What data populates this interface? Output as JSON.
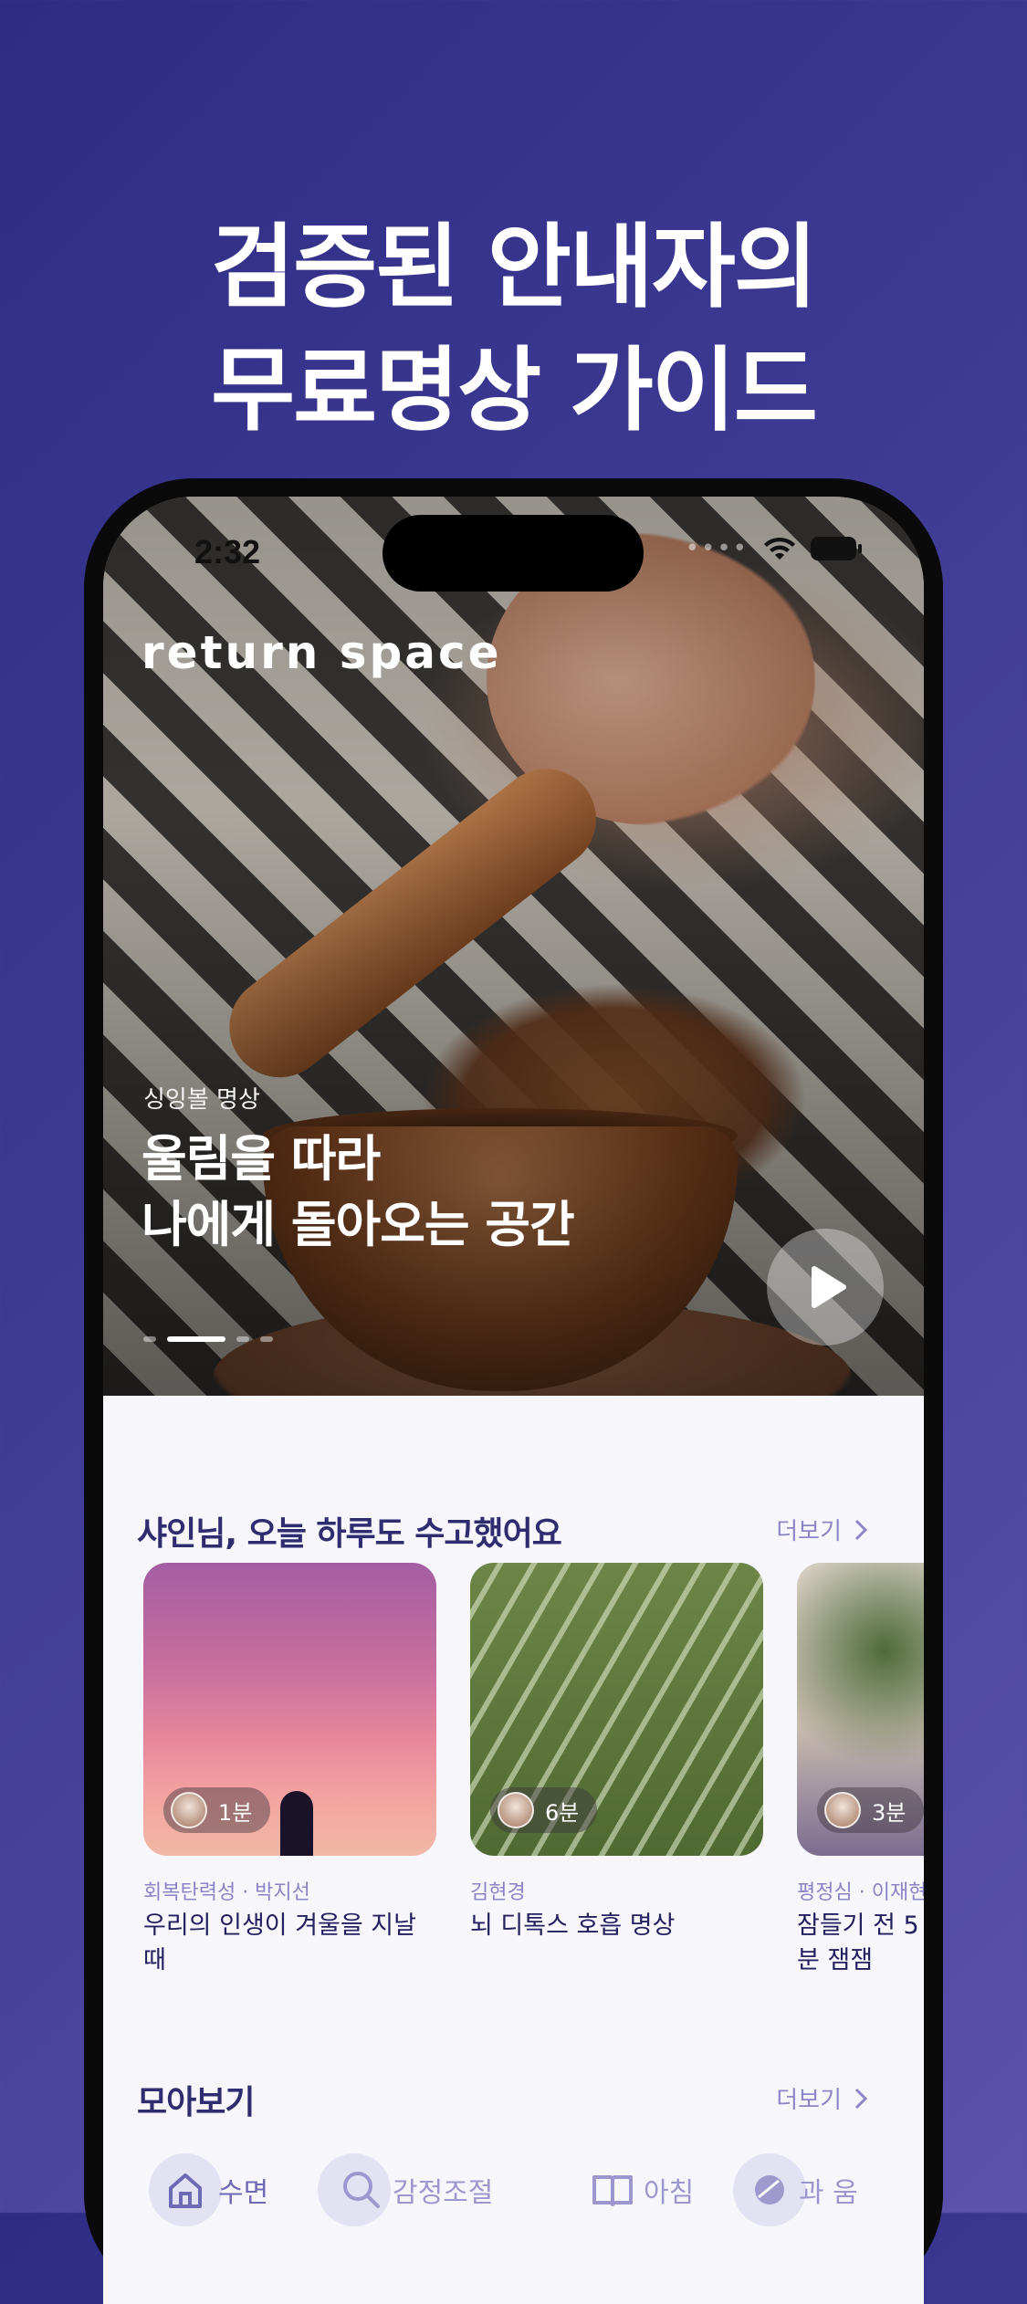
{
  "promo": {
    "headline_line1": "검증된 안내자의",
    "headline_line2": "무료명상 가이드"
  },
  "status_bar": {
    "time": "2:32"
  },
  "app": {
    "brand": "return space"
  },
  "hero": {
    "category": "싱잉볼 명상",
    "title_line1": "울림을 따라",
    "title_line2": "나에게 돌아오는 공간",
    "carousel_active_index": 1,
    "carousel_count": 4
  },
  "greeting_section": {
    "title": "샤인님, 오늘 하루도 수고했어요",
    "more": "더보기",
    "cards": [
      {
        "duration": "1분",
        "meta": "회복탄력성 · 박지선",
        "title": "우리의 인생이 겨울을 지날 때"
      },
      {
        "duration": "6분",
        "meta": "김현경",
        "title": "뇌 디톡스 호흡 명상"
      },
      {
        "duration": "3분",
        "meta": "평정심 · 이재현",
        "title": "잠들기 전 5분 잼잼"
      }
    ]
  },
  "collection_section": {
    "title": "모아보기",
    "more": "더보기"
  },
  "tabbar": {
    "items": [
      {
        "label": "수면",
        "icon": "home-icon"
      },
      {
        "label": "감정조절",
        "icon": "search-icon"
      },
      {
        "label": "아침",
        "icon": "book-icon"
      },
      {
        "label": "과 움",
        "icon": "leaf-icon"
      }
    ]
  },
  "colors": {
    "background_start": "#2f2c86",
    "background_end": "#5c51ad",
    "section_title": "#2f2c70",
    "accent_soft": "#8c86c8"
  }
}
